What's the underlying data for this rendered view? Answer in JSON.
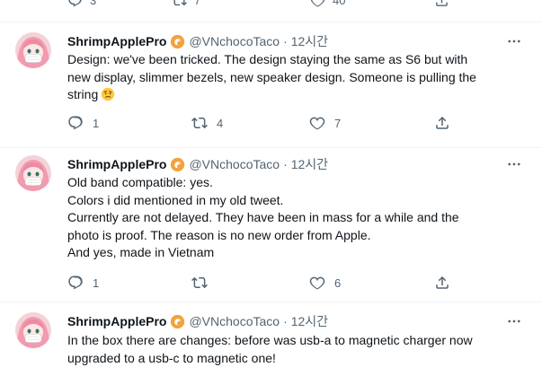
{
  "top_actions": {
    "reply_count": "3",
    "retweet_count": "7",
    "like_count": "40"
  },
  "tweets": [
    {
      "name": "ShrimpApplePro",
      "handle": "@VNchocoTaco",
      "separator": "·",
      "time": "12시간",
      "lines": [
        "Design: we've been tricked. The design staying the same as S6 but with",
        "new display, slimmer bezels, new speaker design. Someone is pulling the",
        "string"
      ],
      "emoji": "raised-eyebrow-face",
      "reply_count": "1",
      "retweet_count": "4",
      "like_count": "7",
      "share_count": ""
    },
    {
      "name": "ShrimpApplePro",
      "handle": "@VNchocoTaco",
      "separator": "·",
      "time": "12시간",
      "lines": [
        "Old band compatible: yes.",
        "Colors i did mentioned in my old tweet.",
        "Currently are not delayed. They have been in mass for a while and the",
        "photo is proof. The reason is no new order from Apple.",
        "And yes, made in Vietnam"
      ],
      "reply_count": "1",
      "retweet_count": "",
      "like_count": "6",
      "share_count": ""
    },
    {
      "name": "ShrimpApplePro",
      "handle": "@VNchocoTaco",
      "separator": "·",
      "time": "12시간",
      "lines": [
        "In the box there are changes: before was usb-a to magnetic charger now",
        "upgraded to a usb-c to magnetic one!"
      ]
    }
  ],
  "colors": {
    "text": "#0f1419",
    "secondary": "#536471",
    "divider": "#eff3f4",
    "badge": "#f4a23a"
  },
  "icons": [
    "reply-icon",
    "retweet-icon",
    "like-icon",
    "share-icon",
    "more-icon",
    "shrimp-badge-icon",
    "avatar"
  ]
}
